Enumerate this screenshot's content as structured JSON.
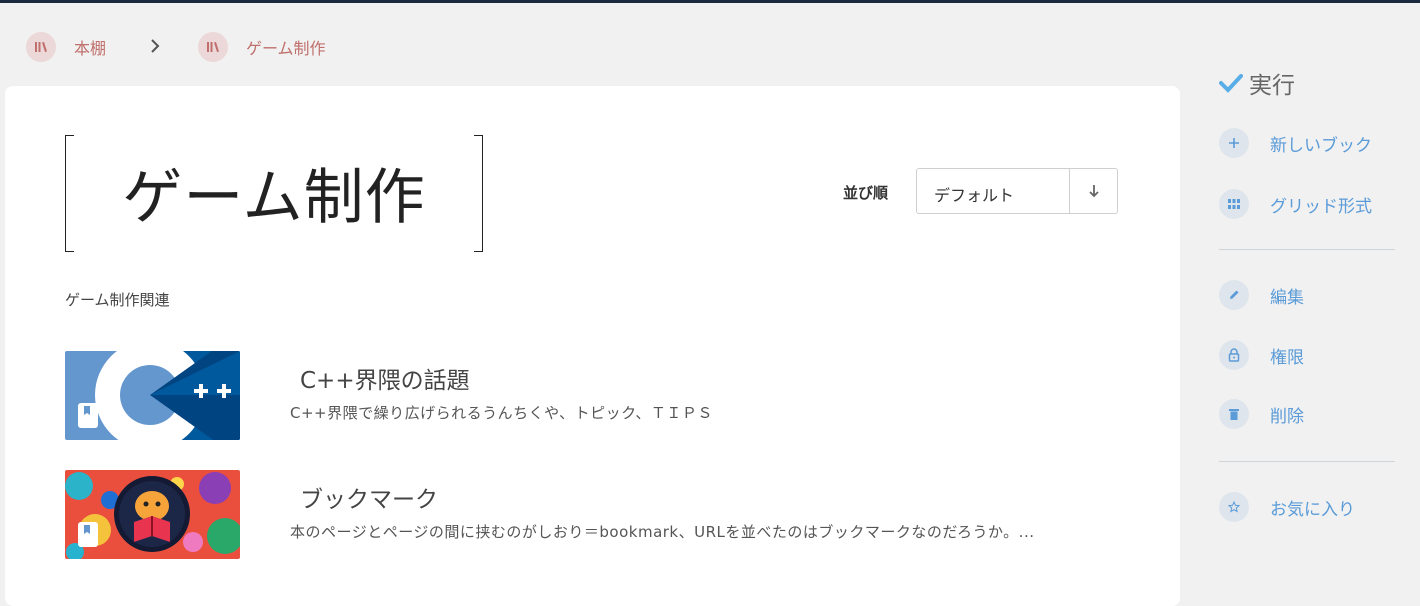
{
  "breadcrumb": {
    "items": [
      {
        "label": "本棚",
        "icon": "library-icon"
      },
      {
        "label": "ゲーム制作",
        "icon": "library-icon"
      }
    ],
    "separator_icon": "chevron-right-icon"
  },
  "book": {
    "title": "ゲーム制作",
    "description": "ゲーム制作関連"
  },
  "sort": {
    "label": "並び順",
    "value": "デフォルト",
    "direction_icon": "arrow-down-icon"
  },
  "pages": [
    {
      "title": "C++界隈の話題",
      "description": "C++界隈で繰り広げられるうんちくや、トピック、ＴＩＰＳ",
      "thumbnail": "cpp-logo-image",
      "badge_icon": "bookmark-icon"
    },
    {
      "title": "ブックマーク",
      "description": "本のページとページの間に挟むのがしおり＝bookmark、URLを並べたのはブックマークなのだろうか。...",
      "thumbnail": "reading-character-image",
      "badge_icon": "bookmark-icon"
    }
  ],
  "actions": {
    "heading": "実行",
    "heading_icon": "check-icon",
    "items": [
      {
        "label": "新しいブック",
        "icon": "plus-icon"
      },
      {
        "label": "グリッド形式",
        "icon": "grid-icon"
      },
      {
        "label": "編集",
        "icon": "pencil-icon"
      },
      {
        "label": "権限",
        "icon": "lock-icon"
      },
      {
        "label": "削除",
        "icon": "trash-icon"
      },
      {
        "label": "お気に入り",
        "icon": "star-icon"
      }
    ]
  },
  "colors": {
    "accent": "#5a9bd8",
    "breadcrumb": "#c0706c",
    "topbar": "#1b2a3e"
  }
}
